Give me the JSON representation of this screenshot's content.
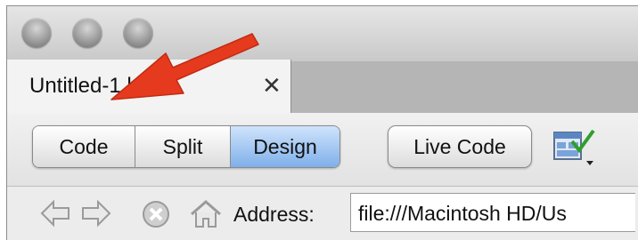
{
  "window": {
    "traffic_lights": [
      "close",
      "minimize",
      "zoom"
    ]
  },
  "tab": {
    "title": "Untitled-1.html*",
    "close_label": "✕"
  },
  "toolbar": {
    "segments": [
      "Code",
      "Split",
      "Design"
    ],
    "active_segment": "Design",
    "live_code_label": "Live Code",
    "view_options_icon": "visual-aids-icon"
  },
  "navbar": {
    "icons": [
      "back-arrow-icon",
      "forward-arrow-icon",
      "stop-icon",
      "home-icon"
    ],
    "address_label": "Address:",
    "address_value": "file:///Macintosh HD/Us"
  },
  "annotation": {
    "color": "#e63a1e",
    "icon": "red-arrow-annotation"
  },
  "colors": {
    "active_segment": "#7fb0ea",
    "tab_strip": "#b5b5b5"
  }
}
